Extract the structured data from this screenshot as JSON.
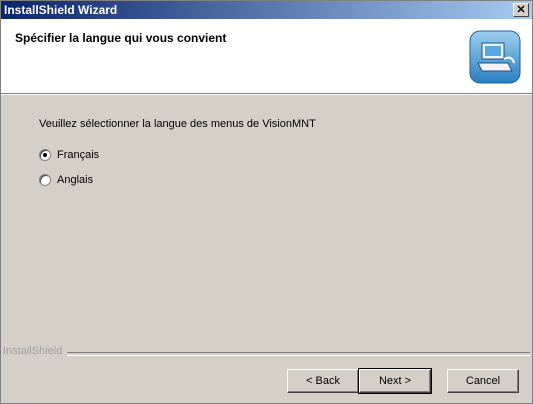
{
  "window": {
    "title": "InstallShield Wizard",
    "close_label": "✕",
    "accent_color": "#0a246a"
  },
  "header": {
    "title": "Spécifier la langue qui vous convient",
    "icon": "installer-computer-icon"
  },
  "main": {
    "instruction": "Veuillez sélectionner la langue des menus de VisionMNT",
    "options": [
      {
        "label": "Français",
        "selected": true
      },
      {
        "label": "Anglais",
        "selected": false
      }
    ]
  },
  "footer": {
    "brand": "InstallShield",
    "back_label": "< Back",
    "next_label": "Next >",
    "cancel_label": "Cancel"
  }
}
